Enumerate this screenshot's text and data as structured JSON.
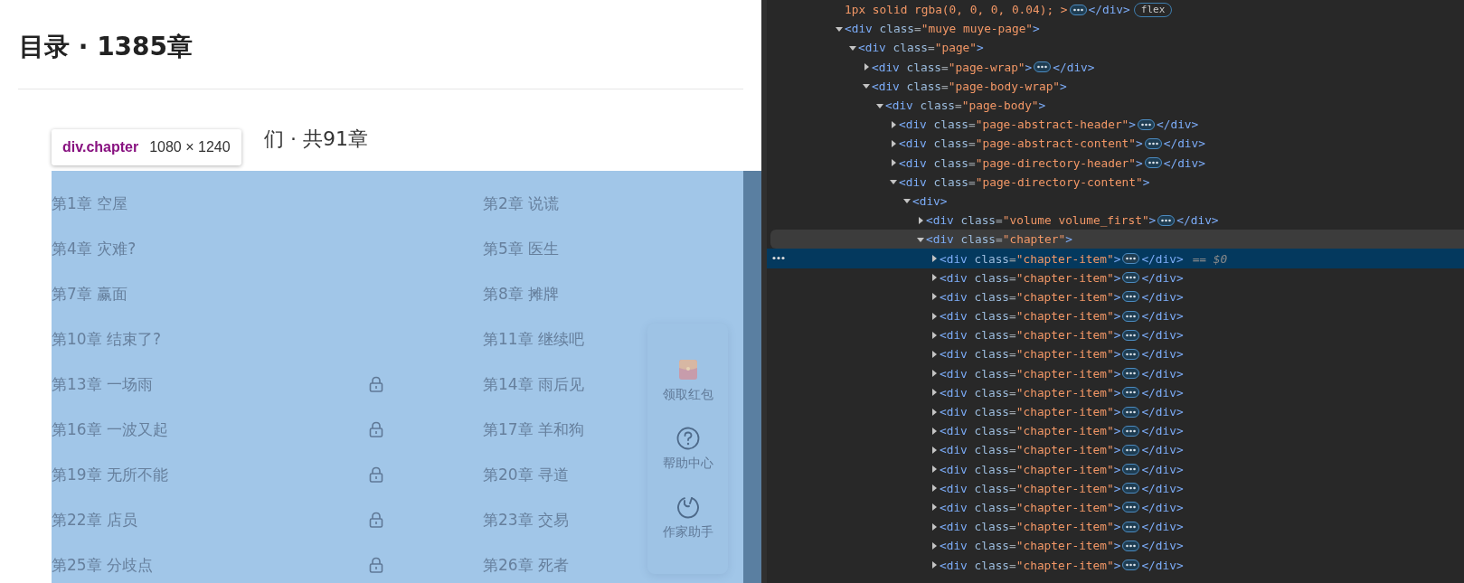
{
  "page": {
    "heading": "目录 · 1385章",
    "volume_title": "们 · 共91章",
    "tooltip": {
      "selector": "div.chapter",
      "size": "1080 × 1240"
    },
    "chapters": [
      {
        "title": "第1章 空屋",
        "locked": false
      },
      {
        "title": "第2章 说谎",
        "locked": false
      },
      {
        "title": "第4章 灾难?",
        "locked": false
      },
      {
        "title": "第5章 医生",
        "locked": false
      },
      {
        "title": "第7章 赢面",
        "locked": false
      },
      {
        "title": "第8章 摊牌",
        "locked": false
      },
      {
        "title": "第10章 结束了?",
        "locked": false
      },
      {
        "title": "第11章 继续吧",
        "locked": false
      },
      {
        "title": "第13章 一场雨",
        "locked": true
      },
      {
        "title": "第14章 雨后见",
        "locked": false
      },
      {
        "title": "第16章 一波又起",
        "locked": true
      },
      {
        "title": "第17章 羊和狗",
        "locked": false
      },
      {
        "title": "第19章 无所不能",
        "locked": true
      },
      {
        "title": "第20章 寻道",
        "locked": false
      },
      {
        "title": "第22章 店员",
        "locked": true
      },
      {
        "title": "第23章 交易",
        "locked": false
      },
      {
        "title": "第25章 分歧点",
        "locked": true
      },
      {
        "title": "第26章 死者",
        "locked": false
      }
    ],
    "side_tools": [
      {
        "kind": "red-packet",
        "label": "领取红包"
      },
      {
        "kind": "help",
        "label": "帮助中心"
      },
      {
        "kind": "writer",
        "label": "作家助手"
      }
    ]
  },
  "dom_tree": [
    {
      "kind": "fragment",
      "text": "1px solid rgba(0, 0, 0, 0.04); >",
      "close": "</div>",
      "badge": "flex"
    },
    {
      "kind": "element",
      "open": "<div class=\"muye muye-page\">",
      "expanded": true,
      "selected": false,
      "hovered": false,
      "children": [
        {
          "kind": "element",
          "open": "<div class=\"page\">",
          "expanded": true,
          "selected": false,
          "hovered": false,
          "children": [
            {
              "kind": "element",
              "open": "<div class=\"page-wrap\">",
              "close": "</div>",
              "expanded": false,
              "selected": false,
              "hovered": false
            },
            {
              "kind": "element",
              "open": "<div class=\"page-body-wrap\">",
              "expanded": true,
              "selected": false,
              "hovered": false,
              "children": [
                {
                  "kind": "element",
                  "open": "<div class=\"page-body\">",
                  "expanded": true,
                  "selected": false,
                  "hovered": false,
                  "children": [
                    {
                      "kind": "element",
                      "open": "<div class=\"page-abstract-header\">",
                      "close": "</div>",
                      "expanded": false,
                      "selected": false,
                      "hovered": false
                    },
                    {
                      "kind": "element",
                      "open": "<div class=\"page-abstract-content\">",
                      "close": "</div>",
                      "expanded": false,
                      "selected": false,
                      "hovered": false
                    },
                    {
                      "kind": "element",
                      "open": "<div class=\"page-directory-header\">",
                      "close": "</div>",
                      "expanded": false,
                      "selected": false,
                      "hovered": false
                    },
                    {
                      "kind": "element",
                      "open": "<div class=\"page-directory-content\">",
                      "expanded": true,
                      "selected": false,
                      "hovered": false,
                      "children": [
                        {
                          "kind": "element",
                          "open": "<div>",
                          "expanded": true,
                          "selected": false,
                          "hovered": false,
                          "children": [
                            {
                              "kind": "element",
                              "open": "<div class=\"volume volume_first\">",
                              "close": "</div>",
                              "expanded": false,
                              "selected": false,
                              "hovered": false
                            },
                            {
                              "kind": "element",
                              "open": "<div class=\"chapter\">",
                              "expanded": true,
                              "selected": false,
                              "hovered": true,
                              "children": [
                                {
                                  "kind": "element",
                                  "open": "<div class=\"chapter-item\">",
                                  "close": "</div>",
                                  "note": "== $0",
                                  "expanded": false,
                                  "selected": true,
                                  "hovered": false
                                },
                                {
                                  "kind": "element",
                                  "open": "<div class=\"chapter-item\">",
                                  "close": "</div>",
                                  "expanded": false,
                                  "selected": false,
                                  "hovered": false
                                },
                                {
                                  "kind": "element",
                                  "open": "<div class=\"chapter-item\">",
                                  "close": "</div>",
                                  "expanded": false,
                                  "selected": false,
                                  "hovered": false
                                },
                                {
                                  "kind": "element",
                                  "open": "<div class=\"chapter-item\">",
                                  "close": "</div>",
                                  "expanded": false,
                                  "selected": false,
                                  "hovered": false
                                },
                                {
                                  "kind": "element",
                                  "open": "<div class=\"chapter-item\">",
                                  "close": "</div>",
                                  "expanded": false,
                                  "selected": false,
                                  "hovered": false
                                },
                                {
                                  "kind": "element",
                                  "open": "<div class=\"chapter-item\">",
                                  "close": "</div>",
                                  "expanded": false,
                                  "selected": false,
                                  "hovered": false
                                },
                                {
                                  "kind": "element",
                                  "open": "<div class=\"chapter-item\">",
                                  "close": "</div>",
                                  "expanded": false,
                                  "selected": false,
                                  "hovered": false
                                },
                                {
                                  "kind": "element",
                                  "open": "<div class=\"chapter-item\">",
                                  "close": "</div>",
                                  "expanded": false,
                                  "selected": false,
                                  "hovered": false
                                },
                                {
                                  "kind": "element",
                                  "open": "<div class=\"chapter-item\">",
                                  "close": "</div>",
                                  "expanded": false,
                                  "selected": false,
                                  "hovered": false
                                },
                                {
                                  "kind": "element",
                                  "open": "<div class=\"chapter-item\">",
                                  "close": "</div>",
                                  "expanded": false,
                                  "selected": false,
                                  "hovered": false
                                },
                                {
                                  "kind": "element",
                                  "open": "<div class=\"chapter-item\">",
                                  "close": "</div>",
                                  "expanded": false,
                                  "selected": false,
                                  "hovered": false
                                },
                                {
                                  "kind": "element",
                                  "open": "<div class=\"chapter-item\">",
                                  "close": "</div>",
                                  "expanded": false,
                                  "selected": false,
                                  "hovered": false
                                },
                                {
                                  "kind": "element",
                                  "open": "<div class=\"chapter-item\">",
                                  "close": "</div>",
                                  "expanded": false,
                                  "selected": false,
                                  "hovered": false
                                },
                                {
                                  "kind": "element",
                                  "open": "<div class=\"chapter-item\">",
                                  "close": "</div>",
                                  "expanded": false,
                                  "selected": false,
                                  "hovered": false
                                },
                                {
                                  "kind": "element",
                                  "open": "<div class=\"chapter-item\">",
                                  "close": "</div>",
                                  "expanded": false,
                                  "selected": false,
                                  "hovered": false
                                },
                                {
                                  "kind": "element",
                                  "open": "<div class=\"chapter-item\">",
                                  "close": "</div>",
                                  "expanded": false,
                                  "selected": false,
                                  "hovered": false
                                },
                                {
                                  "kind": "element",
                                  "open": "<div class=\"chapter-item\">",
                                  "close": "</div>",
                                  "expanded": false,
                                  "selected": false,
                                  "hovered": false
                                }
                              ]
                            }
                          ]
                        }
                      ]
                    }
                  ]
                }
              ]
            }
          ]
        }
      ]
    }
  ]
}
